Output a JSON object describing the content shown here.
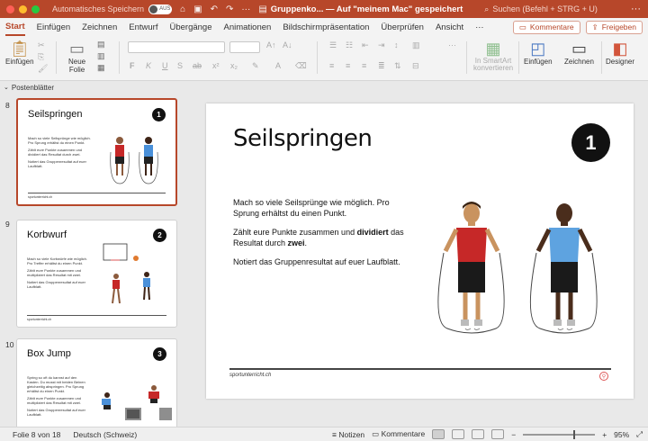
{
  "titlebar": {
    "autosave_label": "Automatisches Speichern",
    "toggle_text": "AUS",
    "doc_title": "Gruppenko... — Auf \"meinem Mac\" gespeichert",
    "search_placeholder": "Suchen (Befehl + STRG + U)",
    "more": "···"
  },
  "tabs": {
    "items": [
      "Start",
      "Einfügen",
      "Zeichnen",
      "Entwurf",
      "Übergänge",
      "Animationen",
      "Bildschirmpräsentation",
      "Überprüfen",
      "Ansicht"
    ],
    "more": "···",
    "comments_label": "Kommentare",
    "share_label": "Freigeben"
  },
  "ribbon": {
    "paste_label": "Einfügen",
    "new_slide_label": "Neue\nFolie",
    "smartart_label": "In SmartArt\nkonvertieren",
    "insert_label": "Einfügen",
    "draw_label": "Zeichnen",
    "designer_label": "Designer"
  },
  "panel": {
    "header": "Postenblätter"
  },
  "thumbnails": [
    {
      "number": "8",
      "title": "Seilspringen",
      "badge": "1",
      "paragraphs": [
        "Mach so viele Seilsprünge wie möglich. Pro Sprung erhältst du einen Punkt.",
        "Zählt eure Punkte zusammen und dividiert das Resultat durch zwei.",
        "Notiert das Gruppenresultat auf euer Laufblatt."
      ],
      "footer": "sportunterricht.ch"
    },
    {
      "number": "9",
      "title": "Korbwurf",
      "badge": "2",
      "paragraphs": [
        "Mach so viele Korbwürfe wie möglich. Pro Treffer erhältst du einen Punkt.",
        "Zählt eure Punkte zusammen und multipliziert das Resultat mit zwei.",
        "Notiert das Gruppenresultat auf euer Laufblatt."
      ],
      "footer": "sportunterricht.ch"
    },
    {
      "number": "10",
      "title": "Box Jump",
      "badge": "3",
      "paragraphs": [
        "Spring so oft du kannst auf den Kasten. Du musst mit beiden Beinen gleichzeitig abspringen. Pro Sprung erhältst du einen Punkt.",
        "Zählt eure Punkte zusammen und multipliziert das Resultat mit zwei.",
        "Notiert das Gruppenresultat auf euer Laufblatt."
      ],
      "footer": "sportunterricht.ch"
    }
  ],
  "slide": {
    "title": "Seilspringen",
    "badge": "1",
    "p1": "Mach so viele Seilsprünge wie möglich. Pro Sprung erhältst du einen Punkt.",
    "p2a": "Zählt eure Punkte zusammen und ",
    "p2b": "dividiert",
    "p2c": " das Resultat durch ",
    "p2d": "zwei",
    "p2e": ".",
    "p3": "Notiert das Gruppenresultat auf euer Laufblatt.",
    "footer": "sportunterricht.ch"
  },
  "status": {
    "slide_info": "Folie 8 von 18",
    "language": "Deutsch (Schweiz)",
    "notes": "Notizen",
    "comments": "Kommentare",
    "zoom": "95%"
  }
}
